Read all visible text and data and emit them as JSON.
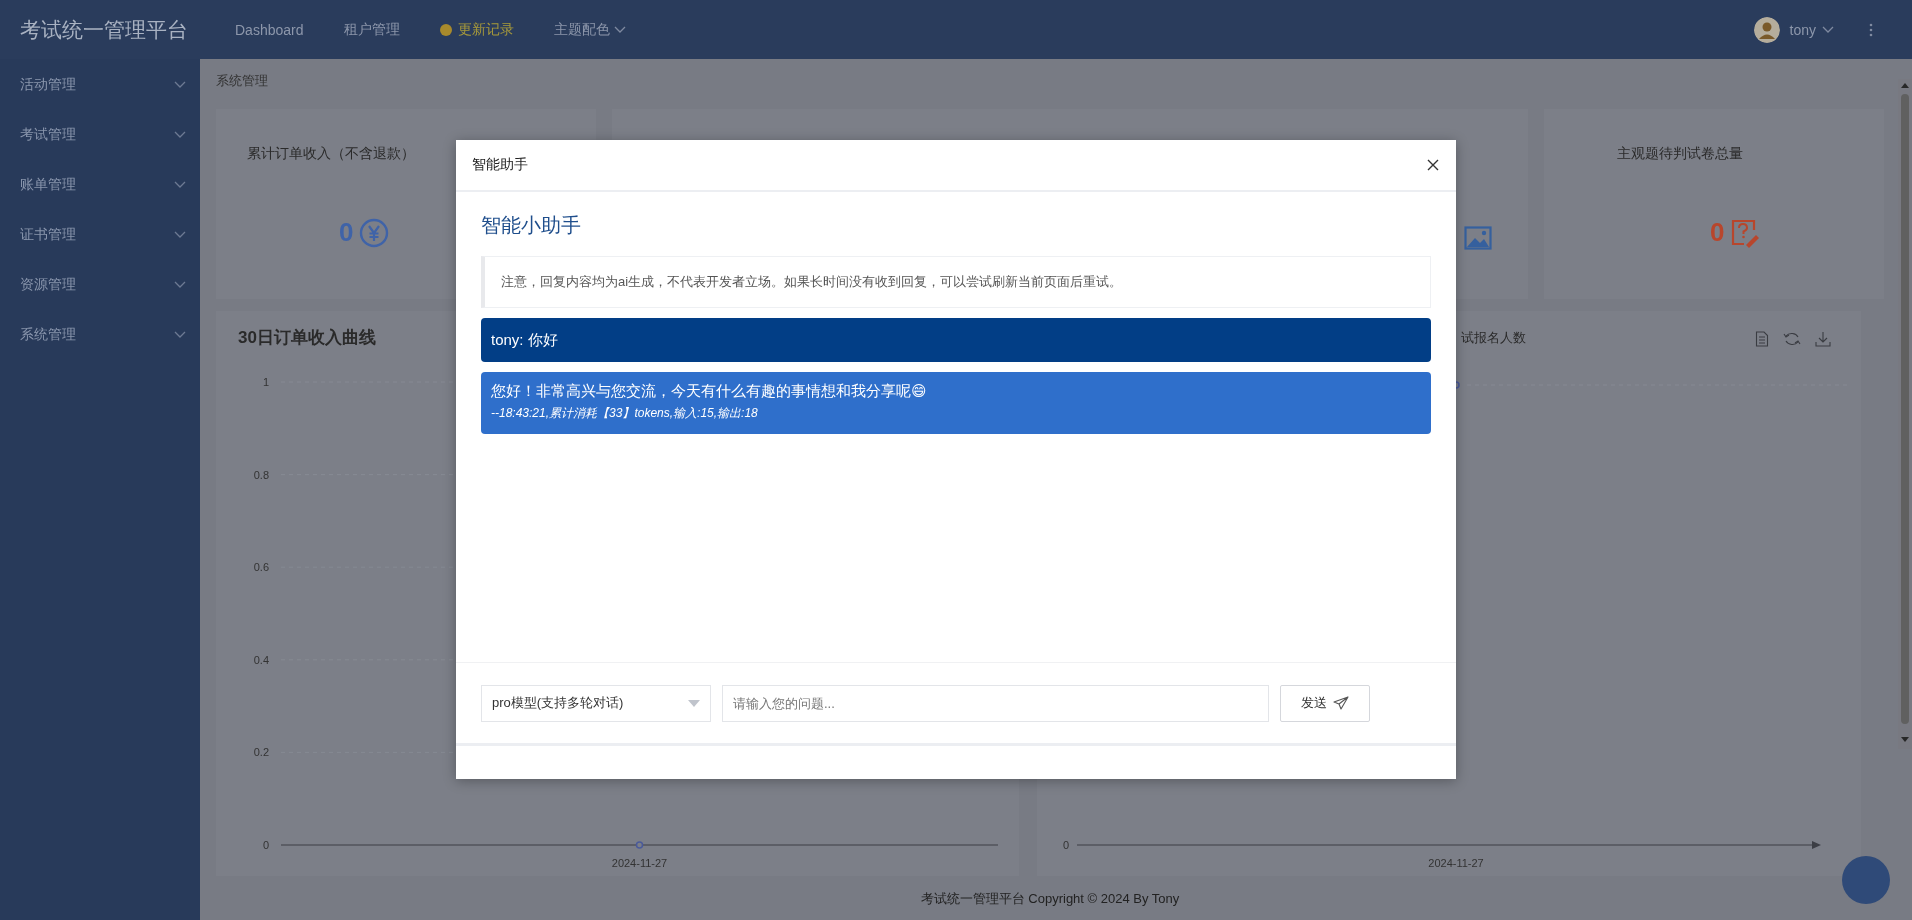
{
  "header": {
    "title": "考试统一管理平台",
    "nav": [
      {
        "label": "Dashboard",
        "kind": "link"
      },
      {
        "label": "租户管理",
        "kind": "link"
      },
      {
        "label": "更新记录",
        "kind": "highlight"
      },
      {
        "label": "主题配色",
        "kind": "dropdown"
      }
    ],
    "user": {
      "name": "tony"
    }
  },
  "sidebar": {
    "items": [
      {
        "label": "活动管理",
        "expanded": false
      },
      {
        "label": "考试管理",
        "expanded": false
      },
      {
        "label": "账单管理",
        "expanded": false
      },
      {
        "label": "证书管理",
        "expanded": false
      },
      {
        "label": "资源管理",
        "expanded": false
      },
      {
        "label": "系统管理",
        "expanded": false
      }
    ]
  },
  "breadcrumb": "系统管理",
  "cards": [
    {
      "title": "累计订单收入（不含退款）",
      "value": "0",
      "kind": "currency",
      "color": "#3f63a8"
    },
    {
      "kind": "picture",
      "color": "#35609e"
    },
    {
      "title": "主观题待判试卷总量",
      "value": "0",
      "kind": "question",
      "color": "#b8462c"
    }
  ],
  "charts": [
    {
      "title": "30日订单收入曲线",
      "chart_data": {
        "type": "line",
        "categories": [
          "2024-11-27"
        ],
        "series": [
          {
            "color": "#4a5a9a",
            "marker": true,
            "values": [
              0
            ]
          }
        ],
        "ylim": [
          0,
          1
        ],
        "yticks": [
          0,
          0.2,
          0.4,
          0.6,
          0.8,
          1
        ],
        "grid": true
      }
    },
    {
      "title": "试报名人数",
      "y_tick": "0",
      "x_label": "2024-11-27"
    }
  ],
  "footer": "考试统一管理平台 Copyright © 2024 By Tony",
  "dialog": {
    "title": "智能助手",
    "heading": "智能小助手",
    "notice": "注意，回复内容均为ai生成，不代表开发者立场。如果长时间没有收到回复，可以尝试刷新当前页面后重试。",
    "messages": [
      {
        "kind": "user",
        "text": "tony: 你好"
      },
      {
        "kind": "assistant",
        "text": "您好！非常高兴与您交流，今天有什么有趣的事情想和我分享呢😄",
        "meta": "--18:43:21,累计消耗【33】tokens,输入:15,输出:18"
      }
    ],
    "model_select": "pro模型(支持多轮对话)",
    "input_placeholder": "请输入您的问题...",
    "send_button": "发送"
  }
}
